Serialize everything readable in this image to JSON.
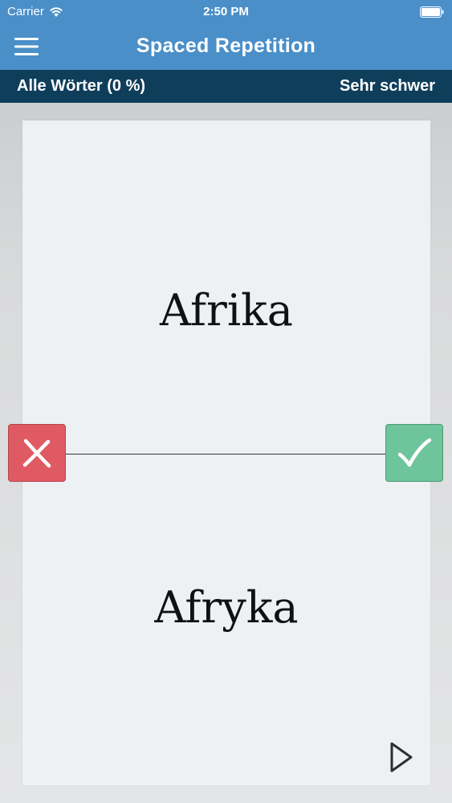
{
  "status_bar": {
    "carrier": "Carrier",
    "time": "2:50 PM",
    "wifi_icon": "wifi-icon",
    "battery_icon": "battery-icon"
  },
  "nav_bar": {
    "title": "Spaced Repetition",
    "menu_icon": "hamburger-menu-icon"
  },
  "sub_bar": {
    "deck_label": "Alle Wörter (0 %)",
    "difficulty_label": "Sehr schwer"
  },
  "card": {
    "front": "Afrika",
    "back": "Afryka"
  },
  "actions": {
    "wrong_icon": "cross-icon",
    "correct_icon": "checkmark-icon",
    "play_icon": "play-icon"
  },
  "colors": {
    "header_blue": "#4a8fc8",
    "subbar_navy": "#0f3e5b",
    "wrong_red": "#e05a63",
    "correct_green": "#6ec49b",
    "card_bg": "#eef1f4"
  }
}
